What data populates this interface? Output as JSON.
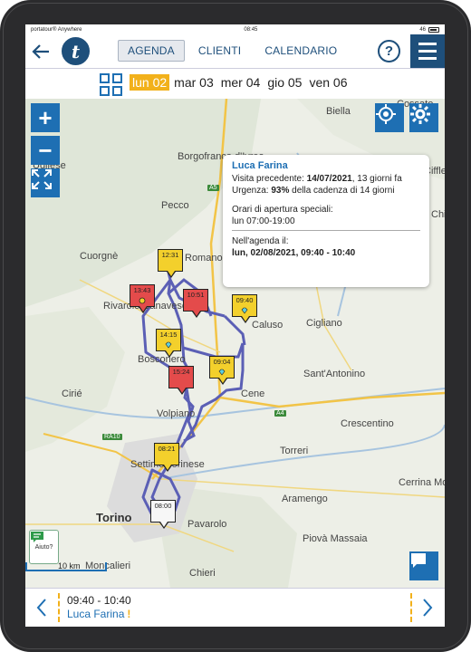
{
  "status_bar": {
    "carrier": "portatour® Anywhere",
    "time": "08:45",
    "battery": "46"
  },
  "nav": {
    "tabs": [
      {
        "label": "AGENDA",
        "active": true
      },
      {
        "label": "CLIENTI",
        "active": false
      },
      {
        "label": "CALENDARIO",
        "active": false
      }
    ],
    "help": "?"
  },
  "days": [
    {
      "label": "lun 02",
      "active": true
    },
    {
      "label": "mar 03",
      "active": false
    },
    {
      "label": "mer 04",
      "active": false
    },
    {
      "label": "gio 05",
      "active": false
    },
    {
      "label": "ven 06",
      "active": false
    }
  ],
  "map": {
    "places": [
      "Biella",
      "Borgofranco d'Ivrea",
      "Pecco",
      "Romano",
      "Cuorgnè",
      "Rivarolo Canavese",
      "Caluso",
      "Cigliano",
      "Bosconero",
      "Sant'Antonino",
      "Cirié",
      "Cene",
      "Volpiano",
      "Crescentino",
      "Settimo Torinese",
      "Torreri",
      "Torino",
      "Aramengo",
      "Pavarolo",
      "Cerrina Mon",
      "Piovà Massaia",
      "Moncalieri",
      "Chieri",
      "Cossato",
      "Ugliese",
      "Ciffle",
      "Chi"
    ],
    "road_labels": [
      "A5",
      "A4",
      "RA10"
    ],
    "scale_label": "10 km",
    "help_label": "Aiuto?"
  },
  "pins": [
    {
      "time": "12:31",
      "color": "yellow"
    },
    {
      "time": "13:43",
      "color": "red"
    },
    {
      "time": "10:51",
      "color": "red"
    },
    {
      "time": "09:40",
      "color": "yellow"
    },
    {
      "time": "14:15",
      "color": "yellow"
    },
    {
      "time": "09:04",
      "color": "yellow"
    },
    {
      "time": "15:24",
      "color": "red"
    },
    {
      "time": "08:21",
      "color": "yellow"
    },
    {
      "time": "08:00",
      "color": "white"
    }
  ],
  "popup": {
    "name": "Luca Farina",
    "prev_visit_label": "Visita precedente: ",
    "prev_visit_date": "14/07/2021",
    "prev_visit_rest": ", 13 giorni fa",
    "urgency_label": "Urgenza: ",
    "urgency_value": "93%",
    "urgency_rest": " della cadenza di 14 giorni",
    "hours_title": "Orari di apertura speciali:",
    "hours_value": "lun  07:00-19:00",
    "agenda_title": "Nell'agenda il:",
    "agenda_value": "lun, 02/08/2021, 09:40 - 10:40"
  },
  "bottom": {
    "time": "09:40 - 10:40",
    "name": "Luca Farina",
    "warning": "!"
  },
  "colors": {
    "primary": "#1e4f7b",
    "accent": "#1e6fb3",
    "highlight": "#f2b11b",
    "route": "#5b5fb5"
  }
}
